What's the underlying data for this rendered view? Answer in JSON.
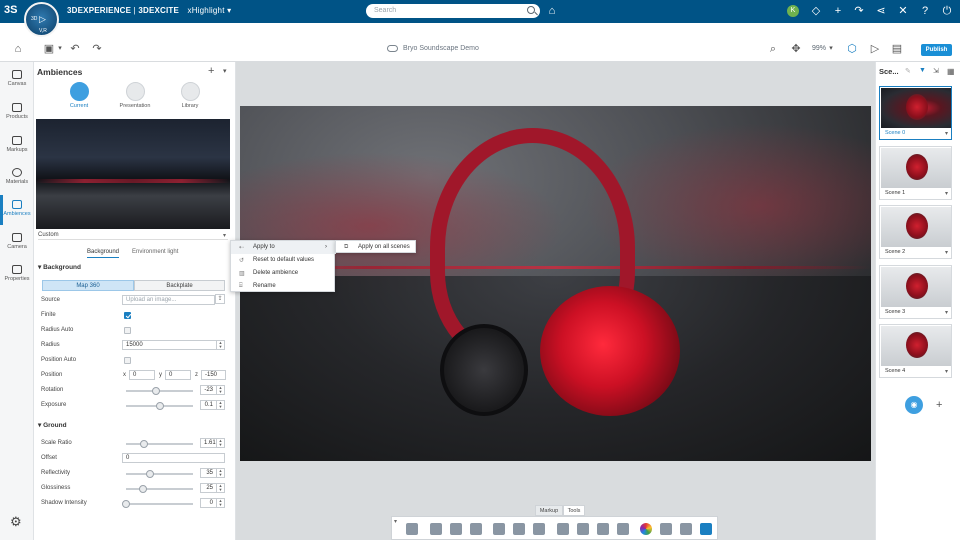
{
  "topbar": {
    "brand_left": "3DEXPERIENCE",
    "brand_sep": " | ",
    "brand_right": "3DEXCITE",
    "app_name": "xHighlight",
    "search_placeholder": "Search",
    "compass_left": "3D",
    "compass_right": "V,R",
    "user_badge": "K"
  },
  "toolbar": {
    "document_title": "Bryo Soundscape Demo",
    "zoom_level": "99%",
    "publish_label": "Publish"
  },
  "rail": {
    "items": [
      {
        "label": "Canvas",
        "icon": "canvas-icon"
      },
      {
        "label": "Products",
        "icon": "cube-icon"
      },
      {
        "label": "Markups",
        "icon": "markup-icon"
      },
      {
        "label": "Materials",
        "icon": "materials-icon"
      },
      {
        "label": "Ambiences",
        "icon": "ambience-icon"
      },
      {
        "label": "Camera",
        "icon": "camera-icon"
      },
      {
        "label": "Properties",
        "icon": "properties-icon"
      }
    ]
  },
  "panel": {
    "title": "Ambiences",
    "modes": [
      {
        "label": "Current"
      },
      {
        "label": "Presentation"
      },
      {
        "label": "Library"
      }
    ],
    "preset_name": "Custom",
    "subtabs": [
      "Background",
      "Environment light"
    ],
    "background_section": "Background",
    "segments": [
      "Map 360",
      "Backplate"
    ],
    "source_label": "Source",
    "source_placeholder": "Upload an image...",
    "finite_label": "Finite",
    "radius_auto_label": "Radius Auto",
    "radius_label": "Radius",
    "radius_value": "15000",
    "position_auto_label": "Position Auto",
    "position_label": "Position",
    "position_x_axis": "x",
    "position_y_axis": "y",
    "position_z_axis": "z",
    "position_x": "0",
    "position_y": "0",
    "position_z": "-150",
    "rotation_label": "Rotation",
    "rotation_value": "-23",
    "exposure_label": "Exposure",
    "exposure_value": "0.1",
    "ground_section": "Ground",
    "scale_ratio_label": "Scale Ratio",
    "scale_ratio_value": "1.61",
    "offset_label": "Offset",
    "offset_value": "0",
    "reflectivity_label": "Reflectivity",
    "reflectivity_value": "35",
    "glossiness_label": "Glossiness",
    "glossiness_value": "25",
    "shadow_label": "Shadow Intensity",
    "shadow_value": "0"
  },
  "context_menu": {
    "items": [
      "Apply to",
      "Reset to default values",
      "Delete ambience",
      "Rename"
    ],
    "submenu": "Apply on all scenes"
  },
  "bottom_tabs": [
    "Markup",
    "Tools"
  ],
  "scenes": {
    "title": "Sce...",
    "items": [
      "Scene 0",
      "Scene 1",
      "Scene 2",
      "Scene 3",
      "Scene 4"
    ]
  },
  "colors": {
    "topbar": "#005386",
    "accent": "#1a7fc1",
    "product_red": "#cc1024"
  }
}
